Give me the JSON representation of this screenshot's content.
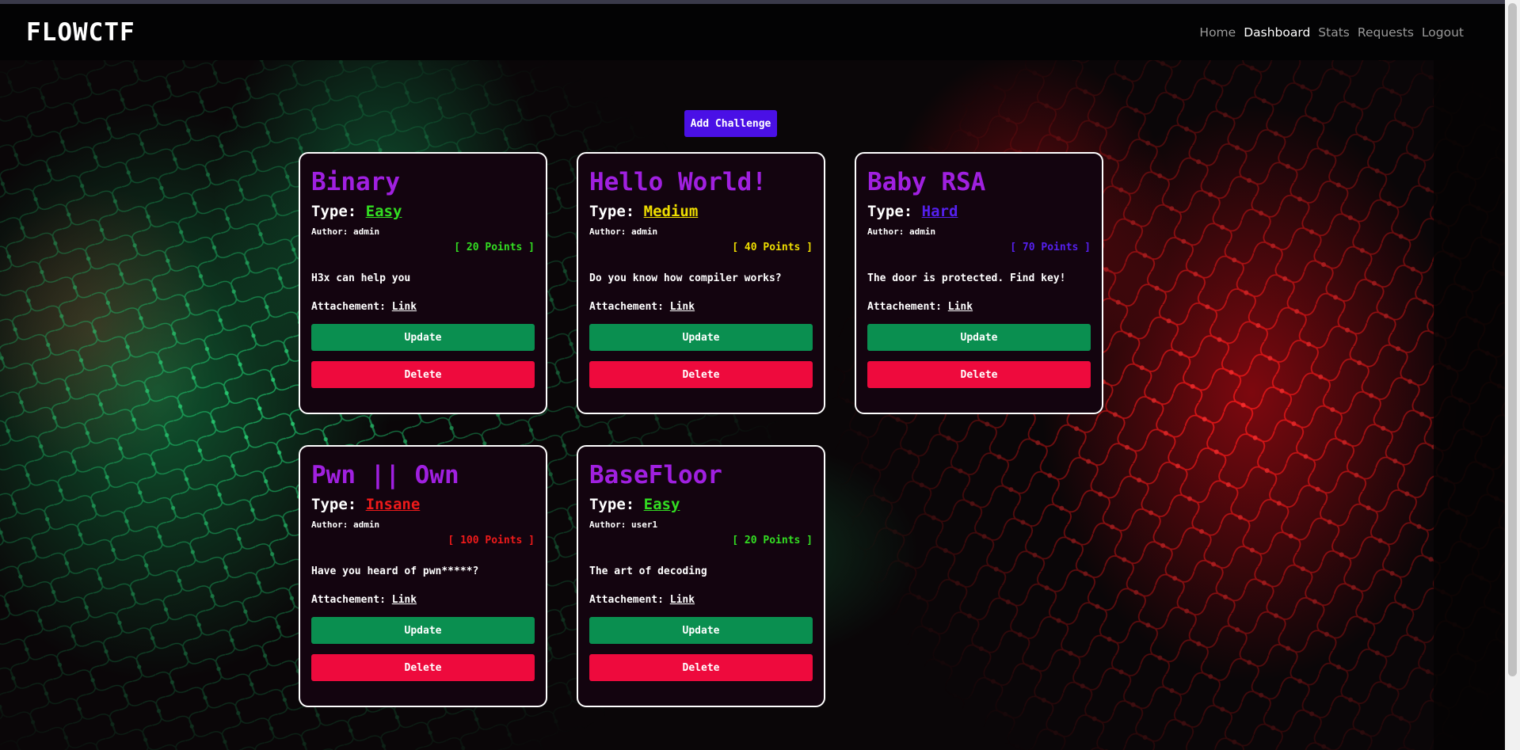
{
  "brand": "FLOWCTF",
  "nav": [
    {
      "label": "Home",
      "active": false
    },
    {
      "label": "Dashboard",
      "active": true
    },
    {
      "label": "Stats",
      "active": false
    },
    {
      "label": "Requests",
      "active": false
    },
    {
      "label": "Logout",
      "active": false
    }
  ],
  "add_button": "Add Challenge",
  "labels": {
    "type": "Type:",
    "author_prefix": "Author:",
    "attachment": "Attachement:",
    "link": "Link",
    "update": "Update",
    "delete": "Delete"
  },
  "colors": {
    "easy": "#33dd22",
    "medium": "#eedd00",
    "hard": "#5520ee",
    "insane": "#ee1a1a"
  },
  "challenges": [
    {
      "title": "Binary",
      "type": "Easy",
      "author": "admin",
      "points": "[ 20 Points ]",
      "description": "H3x can help you",
      "level": "easy"
    },
    {
      "title": "Hello World!",
      "type": "Medium",
      "author": "admin",
      "points": "[ 40 Points ]",
      "description": "Do you know how compiler works?",
      "level": "medium"
    },
    {
      "title": "Baby RSA",
      "type": "Hard",
      "author": "admin",
      "points": "[ 70 Points ]",
      "description": "The door is protected. Find key!",
      "level": "hard"
    },
    {
      "title": "Pwn || Own",
      "type": "Insane",
      "author": "admin",
      "points": "[ 100 Points ]",
      "description": "Have you heard of pwn*****?",
      "level": "insane"
    },
    {
      "title": "BaseFloor",
      "type": "Easy",
      "author": "user1",
      "points": "[ 20 Points ]",
      "description": "The art of decoding",
      "level": "easy"
    }
  ]
}
